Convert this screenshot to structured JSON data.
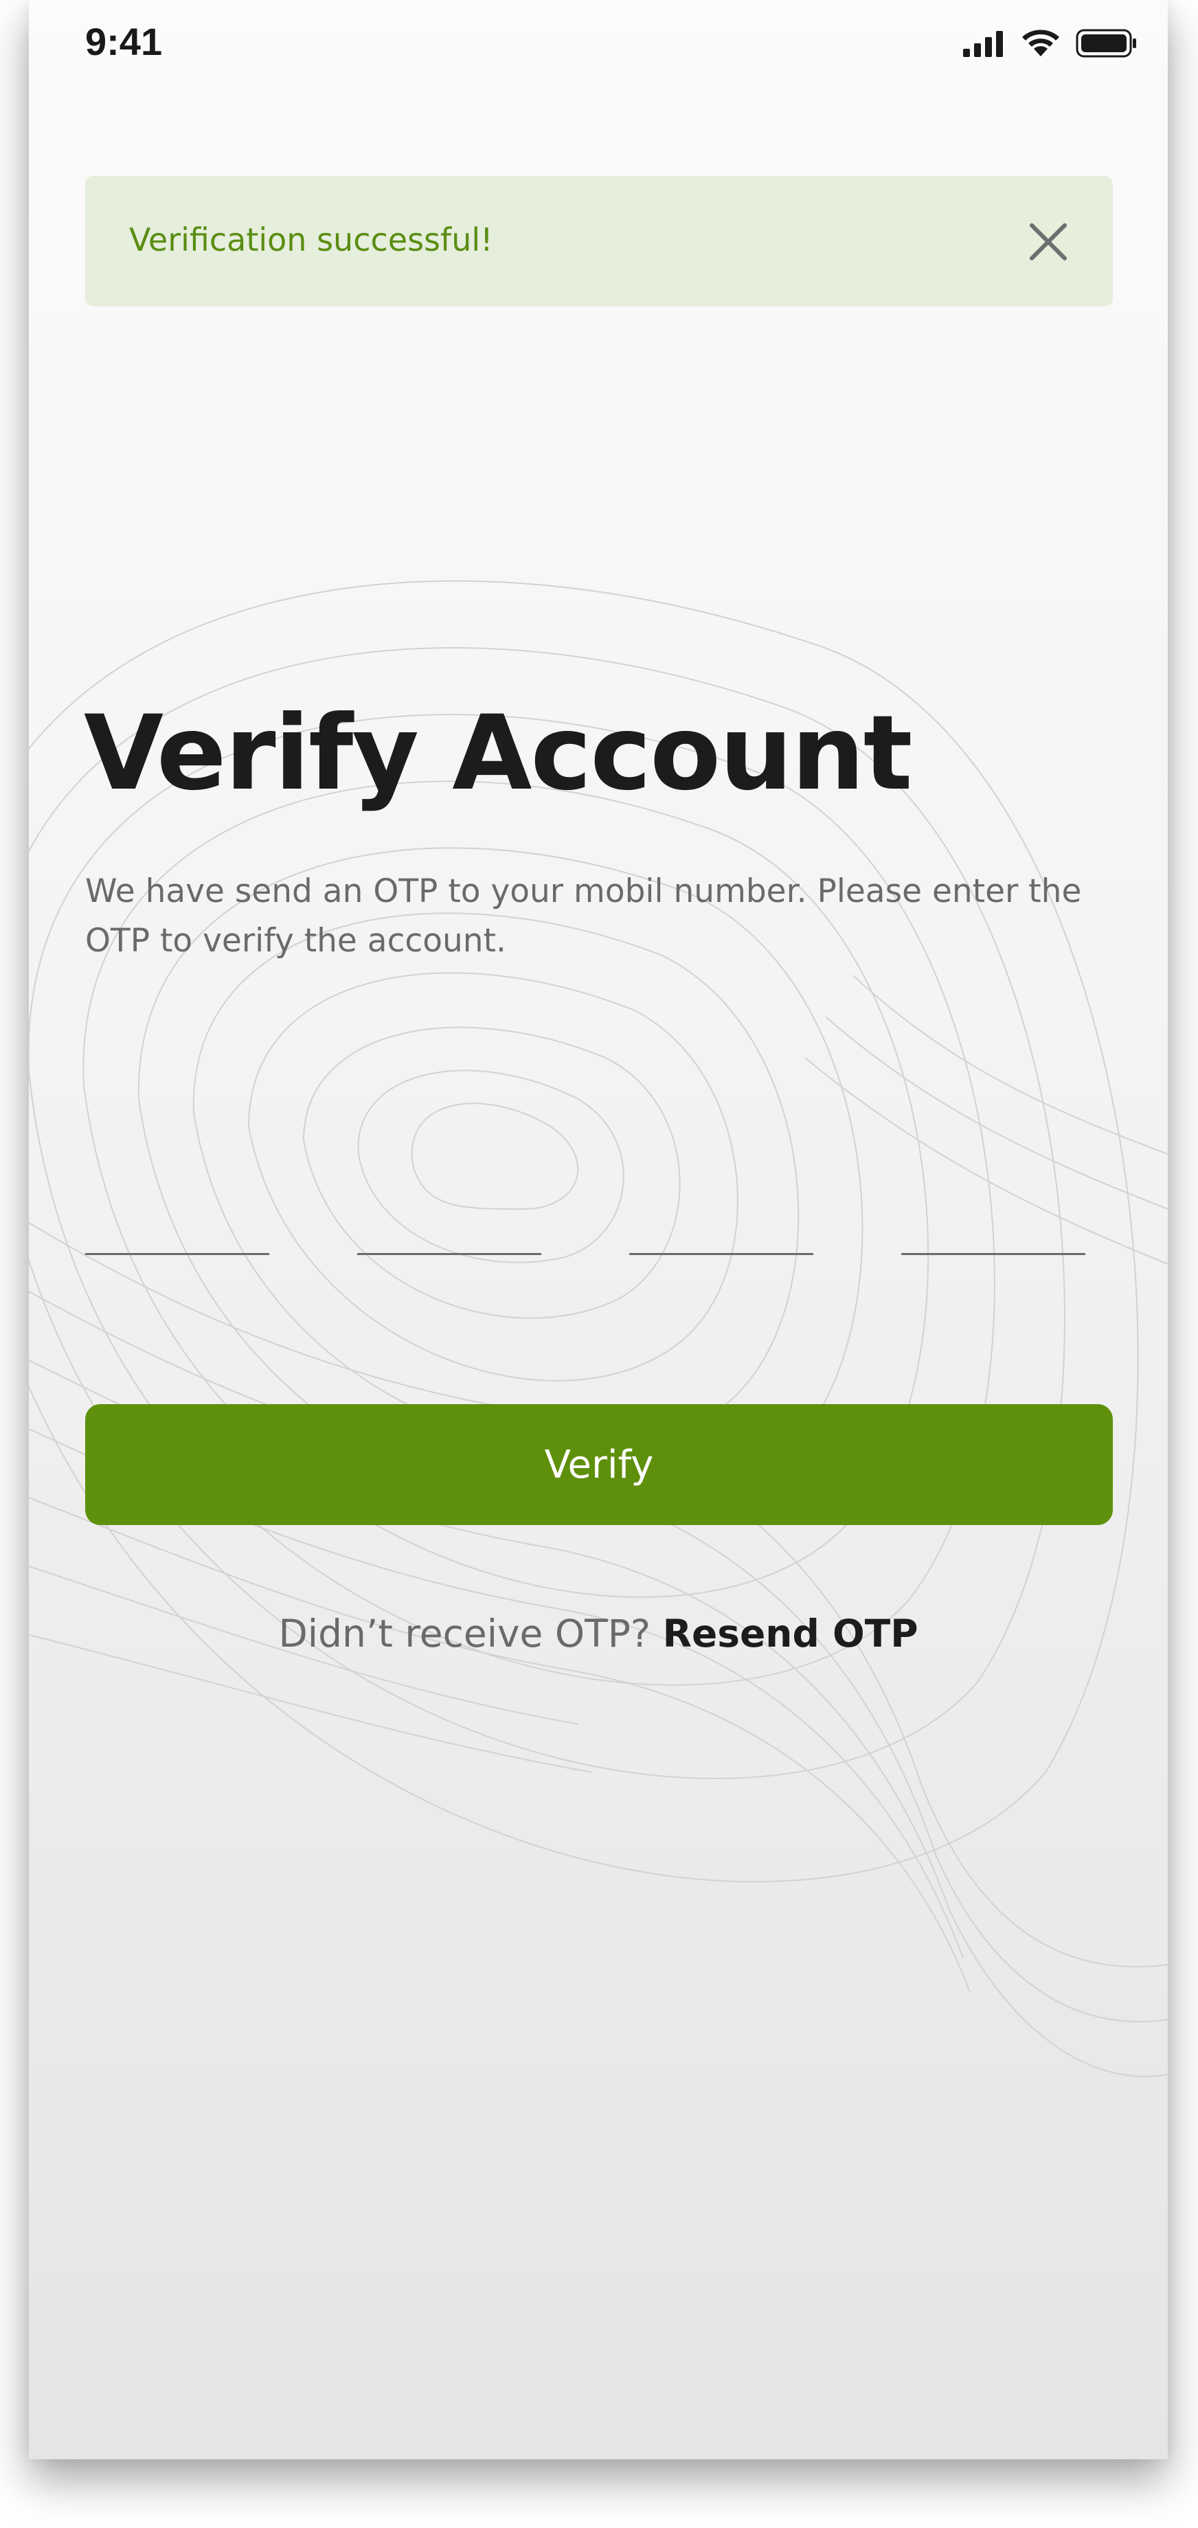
{
  "status_bar": {
    "time": "9:41",
    "icons": [
      "signal-icon",
      "wifi-icon",
      "battery-icon"
    ]
  },
  "toast": {
    "message": "Verification successful!",
    "close_icon": "close-icon",
    "background": "#e6eedc",
    "text_color": "#5a8d12"
  },
  "page": {
    "title": "Verify Account",
    "subtitle": "We have send an OTP to your mobil number. Please enter the OTP to verify the account."
  },
  "otp": {
    "fields": [
      {
        "value": ""
      },
      {
        "value": ""
      },
      {
        "value": ""
      },
      {
        "value": ""
      }
    ]
  },
  "actions": {
    "verify_label": "Verify",
    "button_color": "#5e900c"
  },
  "resend": {
    "prompt": "Didn’t receive OTP?",
    "link_label": "Resend OTP"
  }
}
